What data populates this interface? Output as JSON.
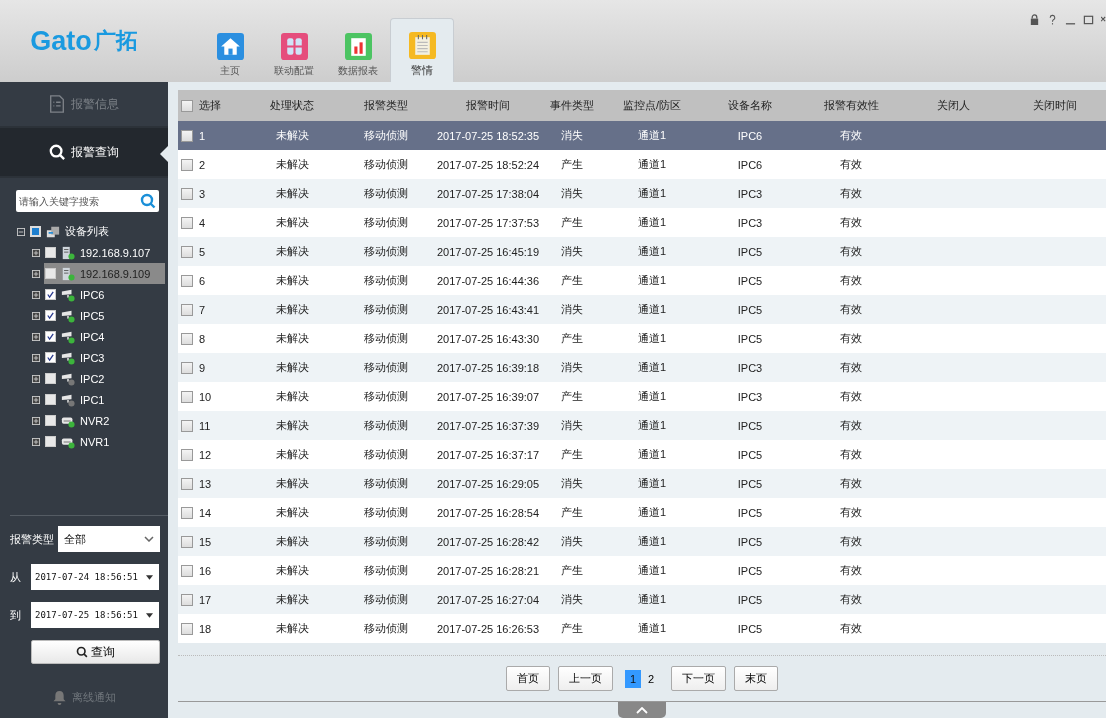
{
  "logo": {
    "latin": "Gato",
    "chinese": "广拓"
  },
  "tabs": [
    {
      "label": "主页",
      "selected": false
    },
    {
      "label": "联动配置",
      "selected": false
    },
    {
      "label": "数据报表",
      "selected": false
    },
    {
      "label": "警情",
      "selected": true
    }
  ],
  "sidebar": {
    "nav": [
      {
        "label": "报警信息",
        "selected": false
      },
      {
        "label": "报警查询",
        "selected": true
      }
    ],
    "search": {
      "placeholder": "请输入关键字搜索"
    },
    "tree": {
      "label": "设备列表",
      "expanded": true,
      "checked": true,
      "children": [
        {
          "label": "192.168.9.107",
          "kind": "server",
          "online": true,
          "checked": false,
          "selected": false,
          "expanded": false
        },
        {
          "label": "192.168.9.109",
          "kind": "server",
          "online": true,
          "checked": false,
          "selected": true,
          "expanded": false
        },
        {
          "label": "IPC6",
          "kind": "camera",
          "online": true,
          "checked": true,
          "selected": false,
          "expanded": false
        },
        {
          "label": "IPC5",
          "kind": "camera",
          "online": true,
          "checked": true,
          "selected": false,
          "expanded": false
        },
        {
          "label": "IPC4",
          "kind": "camera",
          "online": true,
          "checked": true,
          "selected": false,
          "expanded": false
        },
        {
          "label": "IPC3",
          "kind": "camera",
          "online": true,
          "checked": true,
          "selected": false,
          "expanded": false
        },
        {
          "label": "IPC2",
          "kind": "camera",
          "online": false,
          "checked": false,
          "selected": false,
          "expanded": false
        },
        {
          "label": "IPC1",
          "kind": "camera",
          "online": false,
          "checked": false,
          "selected": false,
          "expanded": false
        },
        {
          "label": "NVR2",
          "kind": "nvr",
          "online": true,
          "checked": false,
          "selected": false,
          "expanded": false
        },
        {
          "label": "NVR1",
          "kind": "nvr",
          "online": true,
          "checked": false,
          "selected": false,
          "expanded": false
        }
      ]
    },
    "filters": {
      "type_label": "报警类型",
      "type_value": "全部",
      "from_label": "从",
      "from_value": "2017-07-24 18:56:51",
      "to_label": "到",
      "to_value": "2017-07-25 18:56:51",
      "query_button": "查询"
    },
    "offline_notice": "离线通知"
  },
  "table": {
    "select_all_checked": false,
    "columns": [
      "选择",
      "处理状态",
      "报警类型",
      "报警时间",
      "事件类型",
      "监控点/防区",
      "设备名称",
      "报警有效性",
      "关闭人",
      "关闭时间"
    ],
    "rows": [
      {
        "selected": true,
        "checked": false,
        "cells": [
          "1",
          "未解决",
          "移动侦测",
          "2017-07-25 18:52:35",
          "消失",
          "通道1",
          "IPC6",
          "有效"
        ]
      },
      {
        "selected": false,
        "checked": false,
        "cells": [
          "2",
          "未解决",
          "移动侦测",
          "2017-07-25 18:52:24",
          "产生",
          "通道1",
          "IPC6",
          "有效"
        ]
      },
      {
        "selected": false,
        "checked": false,
        "cells": [
          "3",
          "未解决",
          "移动侦测",
          "2017-07-25 17:38:04",
          "消失",
          "通道1",
          "IPC3",
          "有效"
        ]
      },
      {
        "selected": false,
        "checked": false,
        "cells": [
          "4",
          "未解决",
          "移动侦测",
          "2017-07-25 17:37:53",
          "产生",
          "通道1",
          "IPC3",
          "有效"
        ]
      },
      {
        "selected": false,
        "checked": false,
        "cells": [
          "5",
          "未解决",
          "移动侦测",
          "2017-07-25 16:45:19",
          "消失",
          "通道1",
          "IPC5",
          "有效"
        ]
      },
      {
        "selected": false,
        "checked": false,
        "cells": [
          "6",
          "未解决",
          "移动侦测",
          "2017-07-25 16:44:36",
          "产生",
          "通道1",
          "IPC5",
          "有效"
        ]
      },
      {
        "selected": false,
        "checked": false,
        "cells": [
          "7",
          "未解决",
          "移动侦测",
          "2017-07-25 16:43:41",
          "消失",
          "通道1",
          "IPC5",
          "有效"
        ]
      },
      {
        "selected": false,
        "checked": false,
        "cells": [
          "8",
          "未解决",
          "移动侦测",
          "2017-07-25 16:43:30",
          "产生",
          "通道1",
          "IPC5",
          "有效"
        ]
      },
      {
        "selected": false,
        "checked": false,
        "cells": [
          "9",
          "未解决",
          "移动侦测",
          "2017-07-25 16:39:18",
          "消失",
          "通道1",
          "IPC3",
          "有效"
        ]
      },
      {
        "selected": false,
        "checked": false,
        "cells": [
          "10",
          "未解决",
          "移动侦测",
          "2017-07-25 16:39:07",
          "产生",
          "通道1",
          "IPC3",
          "有效"
        ]
      },
      {
        "selected": false,
        "checked": false,
        "cells": [
          "11",
          "未解决",
          "移动侦测",
          "2017-07-25 16:37:39",
          "消失",
          "通道1",
          "IPC5",
          "有效"
        ]
      },
      {
        "selected": false,
        "checked": false,
        "cells": [
          "12",
          "未解决",
          "移动侦测",
          "2017-07-25 16:37:17",
          "产生",
          "通道1",
          "IPC5",
          "有效"
        ]
      },
      {
        "selected": false,
        "checked": false,
        "cells": [
          "13",
          "未解决",
          "移动侦测",
          "2017-07-25 16:29:05",
          "消失",
          "通道1",
          "IPC5",
          "有效"
        ]
      },
      {
        "selected": false,
        "checked": false,
        "cells": [
          "14",
          "未解决",
          "移动侦测",
          "2017-07-25 16:28:54",
          "产生",
          "通道1",
          "IPC5",
          "有效"
        ]
      },
      {
        "selected": false,
        "checked": false,
        "cells": [
          "15",
          "未解决",
          "移动侦测",
          "2017-07-25 16:28:42",
          "消失",
          "通道1",
          "IPC5",
          "有效"
        ]
      },
      {
        "selected": false,
        "checked": false,
        "cells": [
          "16",
          "未解决",
          "移动侦测",
          "2017-07-25 16:28:21",
          "产生",
          "通道1",
          "IPC5",
          "有效"
        ]
      },
      {
        "selected": false,
        "checked": false,
        "cells": [
          "17",
          "未解决",
          "移动侦测",
          "2017-07-25 16:27:04",
          "消失",
          "通道1",
          "IPC5",
          "有效"
        ]
      },
      {
        "selected": false,
        "checked": false,
        "cells": [
          "18",
          "未解决",
          "移动侦测",
          "2017-07-25 16:26:53",
          "产生",
          "通道1",
          "IPC5",
          "有效"
        ]
      }
    ]
  },
  "pagination": {
    "first": "首页",
    "prev": "上一页",
    "pages": [
      {
        "label": "1",
        "selected": true
      },
      {
        "label": "2",
        "selected": false
      }
    ],
    "next": "下一页",
    "last": "末页"
  }
}
